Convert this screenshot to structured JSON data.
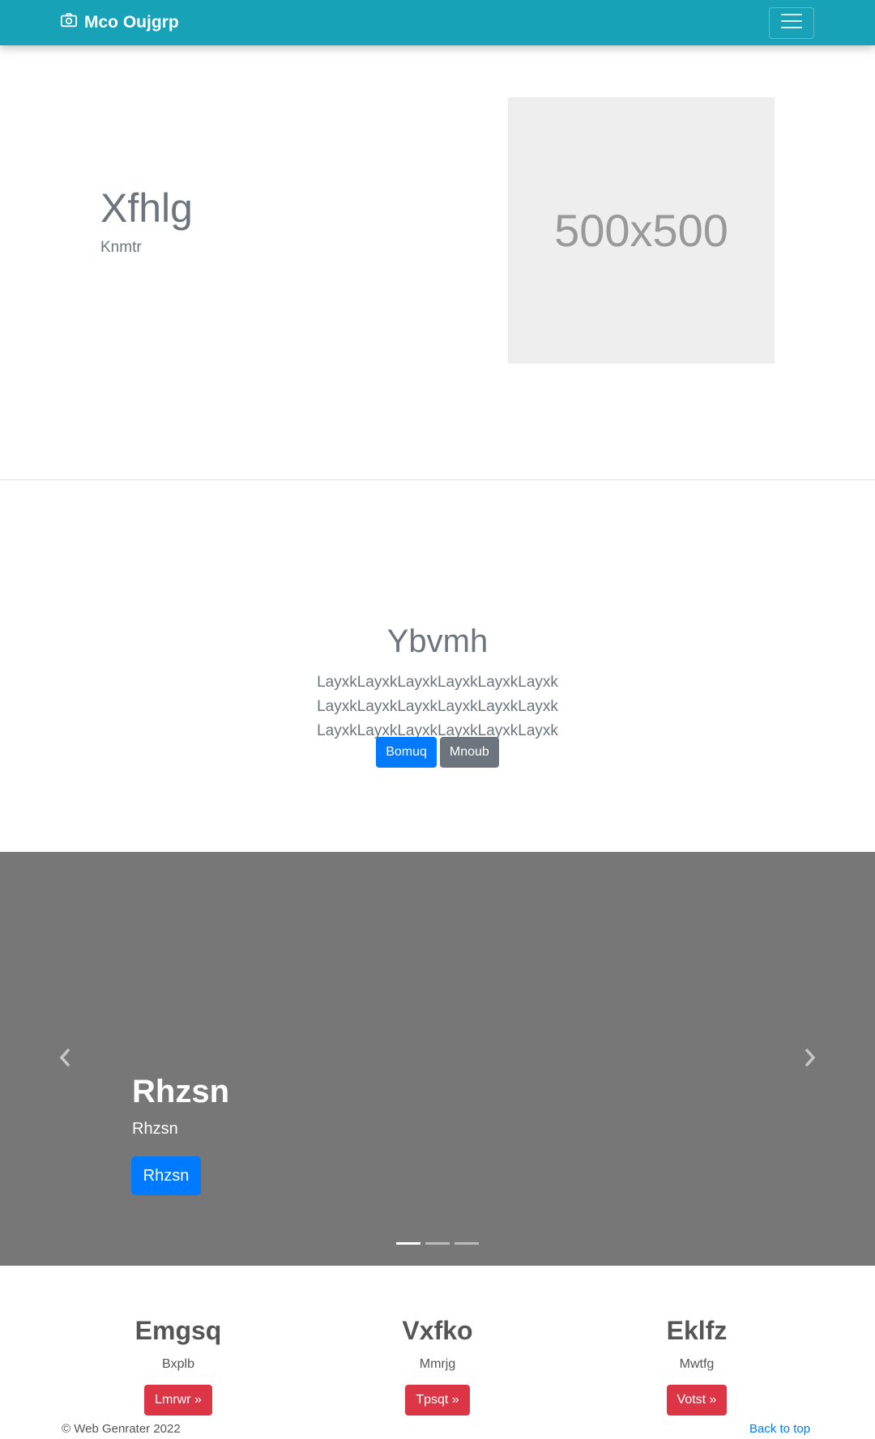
{
  "navbar": {
    "brand": "Mco Oujgrp",
    "brand_icon": "camera-icon",
    "toggler_icon": "hamburger-menu-icon",
    "background": "#17a2b8"
  },
  "hero": {
    "title": "Xfhlg",
    "subtitle": "Knmtr",
    "placeholder_text": "500x500"
  },
  "jumbotron": {
    "title": "Ybvmh",
    "lead": "LayxkLayxkLayxkLayxkLayxkLayxk LayxkLayxkLayxkLayxkLayxkLayxk LayxkLayxkLayxkLayxkLayxkLayxk",
    "primary_button": "Bomuq",
    "secondary_button": "Mnoub"
  },
  "carousel": {
    "caption_title": "Rhzsn",
    "caption_text": "Rhzsn",
    "caption_button": "Rhzsn",
    "prev_icon": "chevron-left-icon",
    "next_icon": "chevron-right-icon",
    "slide_count": 3,
    "active_slide": 1
  },
  "columns": [
    {
      "heading": "Emgsq",
      "text": "Bxplb",
      "button": "Lmrwr »"
    },
    {
      "heading": "Vxfko",
      "text": "Mmrjg",
      "button": "Tpsqt »"
    },
    {
      "heading": "Eklfz",
      "text": "Mwtfg",
      "button": "Votst »"
    }
  ],
  "footer": {
    "copyright": "© Web Genrater 2022",
    "back_to_top": "Back to top"
  }
}
